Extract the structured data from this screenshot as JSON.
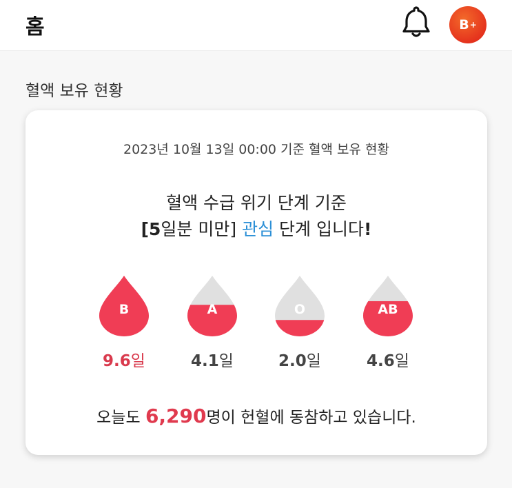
{
  "header": {
    "title": "홈",
    "notification_icon": "bell-icon",
    "avatar_label": "B",
    "avatar_sup": "+"
  },
  "section_title": "혈액 보유 현황",
  "card": {
    "basis_text": "2023년 10월 13일  00:00 기준 혈액 보유 현황",
    "message_line1": "혈액 수급 위기 단계 기준",
    "message_line2_prefix": "[",
    "message_line2_number": "5",
    "message_line2_range": "일분 미만]",
    "message_line2_level": "관심",
    "message_line2_suffix": " 단계 입니다",
    "message_line2_bang": "!",
    "blood_types": [
      {
        "name": "B",
        "days": "9.6",
        "unit": "일",
        "fill_fraction": 1.0
      },
      {
        "name": "A",
        "days": "4.1",
        "unit": "일",
        "fill_fraction": 0.52
      },
      {
        "name": "O",
        "days": "2.0",
        "unit": "일",
        "fill_fraction": 0.27
      },
      {
        "name": "AB",
        "days": "4.6",
        "unit": "일",
        "fill_fraction": 0.58
      }
    ],
    "footer_prefix": "오늘도 ",
    "donor_count": "6,290",
    "footer_suffix": "명이 헌혈에 동참하고 있습니다."
  },
  "colors": {
    "blood_red": "#f03d55",
    "drop_gray": "#e0e0e0",
    "level_blue": "#2b8fd6",
    "highlight_red": "#d93a4d"
  }
}
